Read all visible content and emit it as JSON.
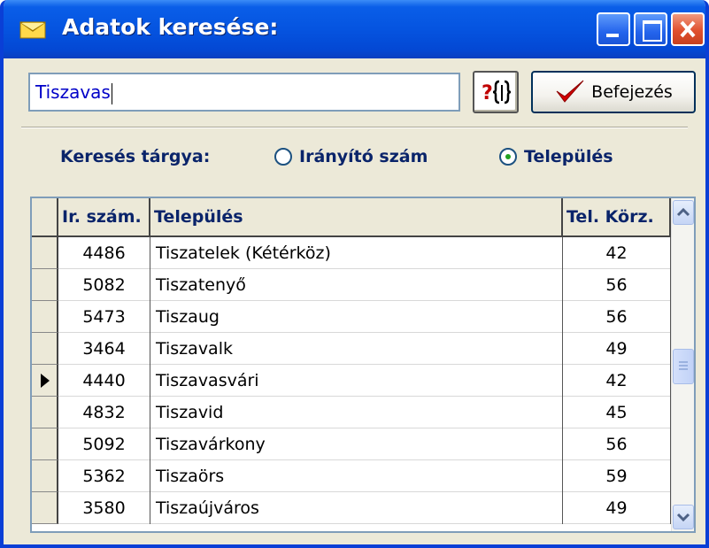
{
  "window": {
    "title": "Adatok keresése:",
    "icon": "envelope-icon"
  },
  "search": {
    "value": "Tiszavas"
  },
  "buttons": {
    "help_icon": "help-search-icon",
    "finish_label": "Befejezés"
  },
  "topic": {
    "label": "Keresés tárgya:",
    "options": [
      {
        "label": "Irányító szám",
        "checked": false
      },
      {
        "label": "Település",
        "checked": true
      }
    ]
  },
  "grid": {
    "columns": [
      "Ir. szám.",
      "Település",
      "Tel. Körz."
    ],
    "rows": [
      {
        "code": "4486",
        "town": "Tiszatelek (Kétérköz)",
        "area": "42",
        "current": false
      },
      {
        "code": "5082",
        "town": "Tiszatenyő",
        "area": "56",
        "current": false
      },
      {
        "code": "5473",
        "town": "Tiszaug",
        "area": "56",
        "current": false
      },
      {
        "code": "3464",
        "town": "Tiszavalk",
        "area": "49",
        "current": false
      },
      {
        "code": "4440",
        "town": "Tiszavasvári",
        "area": "42",
        "current": true
      },
      {
        "code": "4832",
        "town": "Tiszavid",
        "area": "45",
        "current": false
      },
      {
        "code": "5092",
        "town": "Tiszavárkony",
        "area": "56",
        "current": false
      },
      {
        "code": "5362",
        "town": "Tiszaörs",
        "area": "59",
        "current": false
      },
      {
        "code": "3580",
        "town": "Tiszaújváros",
        "area": "49",
        "current": false
      }
    ]
  },
  "colors": {
    "title_bar": "#0554e0",
    "label_text": "#0a246a",
    "input_text": "#0000c8"
  }
}
